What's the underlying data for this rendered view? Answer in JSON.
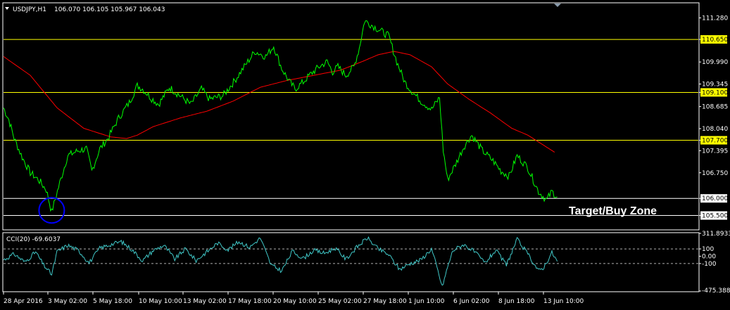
{
  "colors": {
    "background": "#000000",
    "frame": "#ffffff",
    "price_line": "#00ff00",
    "moving_average": "#ff0000",
    "level_line": "#ffff00",
    "level_tag_bg": "#ffff00",
    "level_tag_white": "#ffffff",
    "cci_line": "#40c8c8",
    "circle": "#0000ff",
    "text": "#ffffff"
  },
  "icons": {
    "dropdown": "triangle-down-icon",
    "scroll_marker": "triangle-down-icon"
  },
  "header": {
    "symbol": "USDJPY,H1",
    "ohlc": "106.070 106.105 105.967 106.043"
  },
  "annotation": {
    "text": "Target/Buy Zone"
  },
  "chart_data": [
    {
      "type": "line",
      "symbol": "USDJPY",
      "timeframe": "H1",
      "x": [
        "28 Apr 2016",
        "3 May 02:00",
        "5 May 18:00",
        "10 May 10:00",
        "13 May 02:00",
        "17 May 18:00",
        "20 May 10:00",
        "25 May 02:00",
        "27 May 18:00",
        "1 Jun 10:00",
        "6 Jun 02:00",
        "8 Jun 18:00",
        "13 Jun 10:00"
      ],
      "ylim": [
        105.1,
        111.7
      ],
      "yticks": [
        "111.280",
        "110.650",
        "109.990",
        "109.345",
        "109.100",
        "108.685",
        "108.040",
        "107.700",
        "107.395",
        "106.750",
        "106.000",
        "105.500"
      ],
      "series": [
        {
          "role": "close",
          "anchors": [
            [
              0,
              108.65
            ],
            [
              0.01,
              108.3
            ],
            [
              0.02,
              107.75
            ],
            [
              0.035,
              107.2
            ],
            [
              0.05,
              106.75
            ],
            [
              0.065,
              106.55
            ],
            [
              0.08,
              106.25
            ],
            [
              0.09,
              105.6
            ],
            [
              0.105,
              106.45
            ],
            [
              0.12,
              107.25
            ],
            [
              0.14,
              107.4
            ],
            [
              0.155,
              107.45
            ],
            [
              0.165,
              106.8
            ],
            [
              0.18,
              107.45
            ],
            [
              0.195,
              107.75
            ],
            [
              0.215,
              108.35
            ],
            [
              0.235,
              108.8
            ],
            [
              0.25,
              109.3
            ],
            [
              0.26,
              109.2
            ],
            [
              0.275,
              108.95
            ],
            [
              0.29,
              108.75
            ],
            [
              0.31,
              109.25
            ],
            [
              0.33,
              109.0
            ],
            [
              0.35,
              108.75
            ],
            [
              0.37,
              109.2
            ],
            [
              0.385,
              108.9
            ],
            [
              0.41,
              109.0
            ],
            [
              0.43,
              109.4
            ],
            [
              0.45,
              109.85
            ],
            [
              0.47,
              110.3
            ],
            [
              0.49,
              110.15
            ],
            [
              0.505,
              110.45
            ],
            [
              0.52,
              109.8
            ],
            [
              0.535,
              109.4
            ],
            [
              0.545,
              109.2
            ],
            [
              0.56,
              109.4
            ],
            [
              0.575,
              109.65
            ],
            [
              0.59,
              109.85
            ],
            [
              0.605,
              110.0
            ],
            [
              0.615,
              109.7
            ],
            [
              0.625,
              109.85
            ],
            [
              0.64,
              109.6
            ],
            [
              0.655,
              109.85
            ],
            [
              0.665,
              110.4
            ],
            [
              0.675,
              111.2
            ],
            [
              0.69,
              111.05
            ],
            [
              0.705,
              110.9
            ],
            [
              0.72,
              110.75
            ],
            [
              0.735,
              110.0
            ],
            [
              0.75,
              109.4
            ],
            [
              0.765,
              109.1
            ],
            [
              0.78,
              108.85
            ],
            [
              0.8,
              108.6
            ],
            [
              0.815,
              108.95
            ],
            [
              0.822,
              107.4
            ],
            [
              0.83,
              106.55
            ],
            [
              0.845,
              107.0
            ],
            [
              0.86,
              107.5
            ],
            [
              0.875,
              107.85
            ],
            [
              0.895,
              107.4
            ],
            [
              0.915,
              107.1
            ],
            [
              0.93,
              106.8
            ],
            [
              0.945,
              106.65
            ],
            [
              0.96,
              107.25
            ],
            [
              0.98,
              106.9
            ],
            [
              0.99,
              106.55
            ],
            [
              1.0,
              106.2
            ],
            [
              1.015,
              105.95
            ],
            [
              1.025,
              106.2
            ],
            [
              1.035,
              106.04
            ]
          ]
        },
        {
          "role": "moving_average",
          "anchors": [
            [
              0,
              110.15
            ],
            [
              0.05,
              109.6
            ],
            [
              0.1,
              108.65
            ],
            [
              0.15,
              108.05
            ],
            [
              0.2,
              107.8
            ],
            [
              0.23,
              107.75
            ],
            [
              0.25,
              107.85
            ],
            [
              0.28,
              108.1
            ],
            [
              0.33,
              108.35
            ],
            [
              0.38,
              108.55
            ],
            [
              0.43,
              108.85
            ],
            [
              0.48,
              109.25
            ],
            [
              0.53,
              109.45
            ],
            [
              0.58,
              109.6
            ],
            [
              0.63,
              109.75
            ],
            [
              0.67,
              110.0
            ],
            [
              0.7,
              110.2
            ],
            [
              0.73,
              110.3
            ],
            [
              0.76,
              110.2
            ],
            [
              0.8,
              109.85
            ],
            [
              0.83,
              109.35
            ],
            [
              0.87,
              108.9
            ],
            [
              0.91,
              108.5
            ],
            [
              0.95,
              108.05
            ],
            [
              0.98,
              107.85
            ],
            [
              1.0,
              107.65
            ],
            [
              1.03,
              107.35
            ]
          ]
        }
      ],
      "levels": [
        {
          "value": 110.65,
          "label": "110.650",
          "style": "yellow"
        },
        {
          "value": 109.1,
          "label": "109.100",
          "style": "yellow"
        },
        {
          "value": 107.7,
          "label": "107.700",
          "style": "yellow"
        },
        {
          "value": 106.0,
          "label": "106.000",
          "style": "white"
        },
        {
          "value": 105.5,
          "label": "105.500",
          "style": "white"
        }
      ],
      "annotations": [
        {
          "kind": "circle",
          "x_frac": 0.09,
          "y": 105.65
        },
        {
          "kind": "text",
          "text": "Target/Buy Zone",
          "y": 105.63
        }
      ]
    },
    {
      "type": "line",
      "indicator": "CCI(20)",
      "title": "CCI(20) -69.6037",
      "current_value": -69.6037,
      "ylim": [
        -475.388,
        311.8933
      ],
      "yticks": [
        "311.8933",
        "100",
        "0.00",
        "-100",
        "-475.388"
      ],
      "levels": [
        100,
        -100
      ],
      "anchors": [
        [
          0,
          -50
        ],
        [
          0.02,
          30
        ],
        [
          0.04,
          -80
        ],
        [
          0.06,
          60
        ],
        [
          0.075,
          -120
        ],
        [
          0.09,
          -250
        ],
        [
          0.1,
          60
        ],
        [
          0.12,
          150
        ],
        [
          0.14,
          80
        ],
        [
          0.16,
          -90
        ],
        [
          0.18,
          110
        ],
        [
          0.2,
          160
        ],
        [
          0.22,
          200
        ],
        [
          0.24,
          90
        ],
        [
          0.26,
          -60
        ],
        [
          0.28,
          80
        ],
        [
          0.3,
          150
        ],
        [
          0.32,
          -40
        ],
        [
          0.34,
          100
        ],
        [
          0.36,
          -60
        ],
        [
          0.38,
          60
        ],
        [
          0.4,
          180
        ],
        [
          0.42,
          90
        ],
        [
          0.44,
          200
        ],
        [
          0.46,
          120
        ],
        [
          0.48,
          250
        ],
        [
          0.5,
          -120
        ],
        [
          0.52,
          -200
        ],
        [
          0.54,
          70
        ],
        [
          0.56,
          -30
        ],
        [
          0.58,
          80
        ],
        [
          0.6,
          40
        ],
        [
          0.62,
          110
        ],
        [
          0.64,
          -40
        ],
        [
          0.66,
          120
        ],
        [
          0.68,
          250
        ],
        [
          0.7,
          100
        ],
        [
          0.72,
          20
        ],
        [
          0.74,
          -180
        ],
        [
          0.76,
          -100
        ],
        [
          0.78,
          -50
        ],
        [
          0.8,
          100
        ],
        [
          0.81,
          -150
        ],
        [
          0.82,
          -420
        ],
        [
          0.83,
          -150
        ],
        [
          0.84,
          80
        ],
        [
          0.86,
          160
        ],
        [
          0.88,
          60
        ],
        [
          0.9,
          -90
        ],
        [
          0.92,
          80
        ],
        [
          0.94,
          -120
        ],
        [
          0.96,
          230
        ],
        [
          0.98,
          30
        ],
        [
          1.0,
          -200
        ],
        [
          1.01,
          -150
        ],
        [
          1.025,
          50
        ],
        [
          1.035,
          -70
        ]
      ]
    }
  ],
  "time_labels": [
    "28 Apr 2016",
    "3 May 02:00",
    "5 May 18:00",
    "10 May 10:00",
    "13 May 02:00",
    "17 May 18:00",
    "20 May 10:00",
    "25 May 02:00",
    "27 May 18:00",
    "1 Jun 10:00",
    "6 Jun 02:00",
    "8 Jun 18:00",
    "13 Jun 10:00"
  ]
}
